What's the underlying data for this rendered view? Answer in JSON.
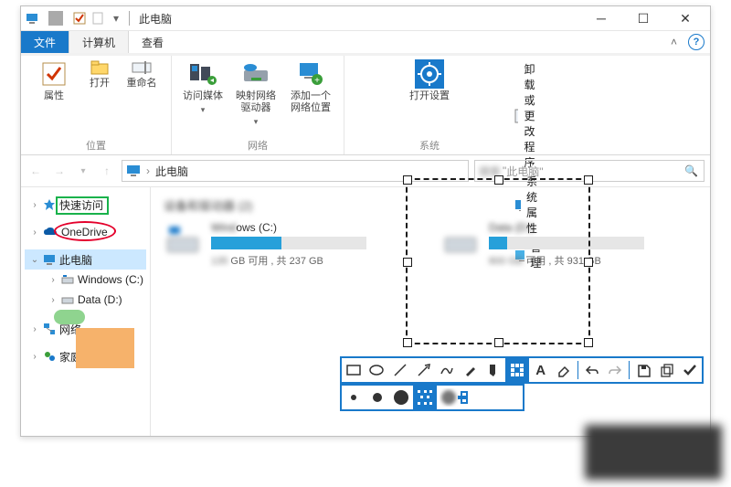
{
  "title": "此电脑",
  "tabs": {
    "file": "文件",
    "computer": "计算机",
    "view": "查看"
  },
  "ribbon": {
    "location_group": "位置",
    "network_group": "网络",
    "system_group": "系统",
    "properties": "属性",
    "open": "打开",
    "rename": "重命名",
    "access_media": "访问媒体",
    "map_drive": "映射网络驱动器",
    "add_location": "添加一个网络位置",
    "open_settings": "打开设置",
    "uninstall": "卸载或更改程序",
    "sys_props": "系统属性",
    "manage": "管理"
  },
  "addressbar": {
    "path": "此电脑"
  },
  "search": {
    "placeholder": "此电脑\""
  },
  "nav": {
    "quick": "快速访问",
    "onedrive": "OneDrive",
    "thispc": "此电脑",
    "winc": "Windows (C:)",
    "datad": "Data (D:)",
    "network": "网络",
    "homegroup": "家庭组"
  },
  "content": {
    "header": "设备和驱动器 (2)",
    "drives": [
      {
        "name": "ows (C:)",
        "usage": "GB 可用 , 共 237 GB",
        "fill": 45
      },
      {
        "name": "Data (D:)",
        "usage": "可用 , 共 931 GB",
        "fill": 20
      }
    ]
  }
}
